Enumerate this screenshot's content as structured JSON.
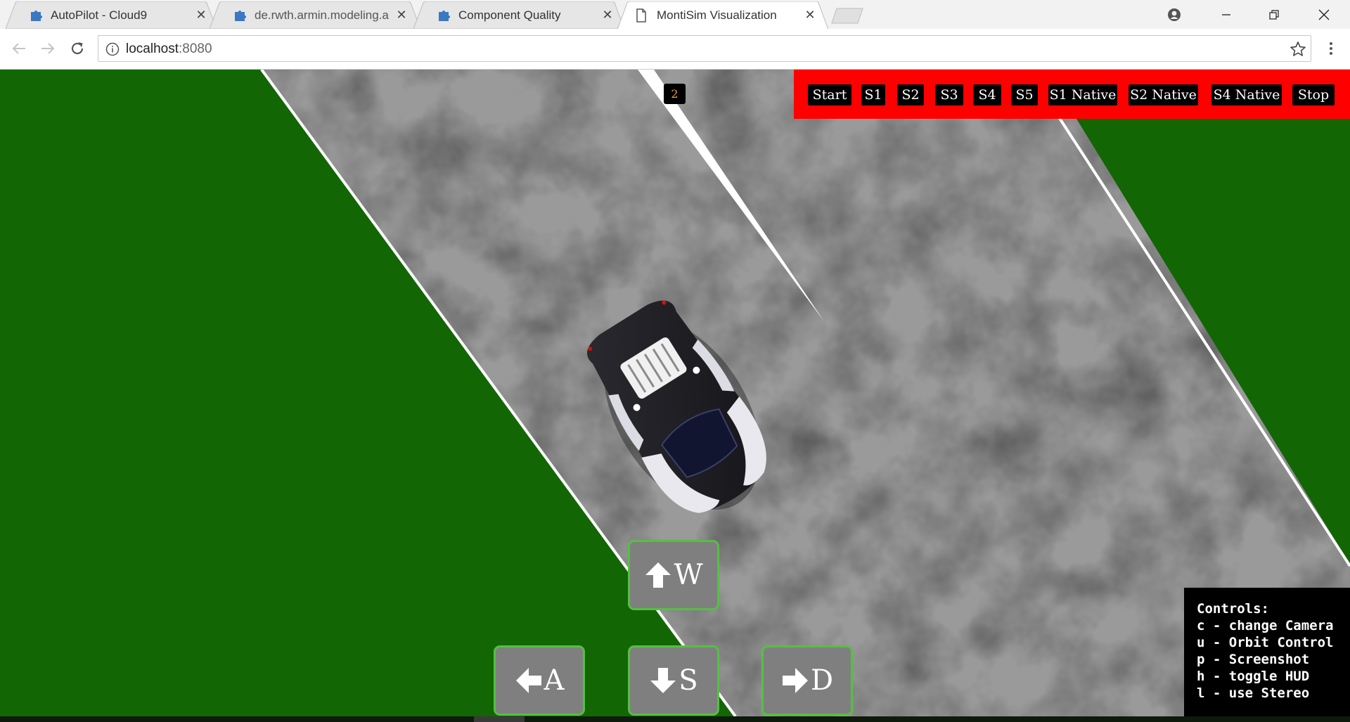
{
  "browser": {
    "tabs": [
      {
        "title": "AutoPilot - Cloud9",
        "icon": "puzzle-icon",
        "active": false
      },
      {
        "title": "de.rwth.armin.modeling.a",
        "icon": "puzzle-icon",
        "active": false
      },
      {
        "title": "Component Quality",
        "icon": "puzzle-icon",
        "active": false
      },
      {
        "title": "MontiSim Visualization",
        "icon": "document-icon",
        "active": true
      }
    ],
    "close_glyph": "✕",
    "address": {
      "host": "localhost",
      "port": ":8080"
    }
  },
  "colors": {
    "grass": "#126604",
    "hud_bar": "#ff0000",
    "key_bg": "#7f7f7f",
    "key_border": "#54c042",
    "counter_text": "#e6a22b"
  },
  "hud": {
    "counter": "2",
    "scenario_buttons": [
      "Start",
      "S1",
      "S2",
      "S3",
      "S4",
      "S5",
      "S1 Native",
      "S2 Native",
      "S4 Native",
      "Stop"
    ]
  },
  "keys": {
    "up": {
      "letter": "W",
      "icon": "arrow-up-icon"
    },
    "left": {
      "letter": "A",
      "icon": "arrow-left-icon"
    },
    "down": {
      "letter": "S",
      "icon": "arrow-down-icon"
    },
    "right": {
      "letter": "D",
      "icon": "arrow-right-icon"
    }
  },
  "controls": {
    "title": "Controls:",
    "lines": [
      "c - change Camera",
      "u - Orbit Control",
      "p - Screenshot",
      "h - toggle HUD",
      "l - use Stereo"
    ]
  }
}
